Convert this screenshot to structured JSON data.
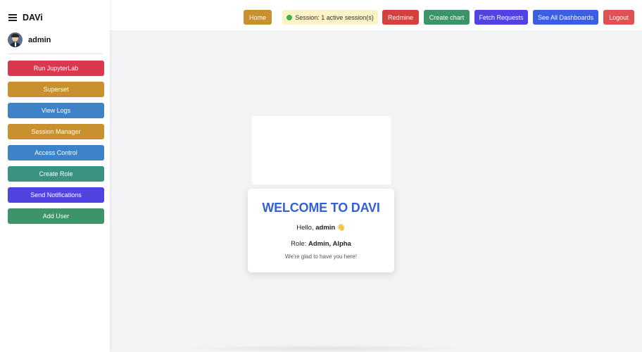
{
  "sidebar": {
    "brand": "DAVi",
    "username": "admin",
    "buttons": [
      {
        "label": "Run JupyterLab",
        "color": "#d9384f"
      },
      {
        "label": "Superset",
        "color": "#c8902f"
      },
      {
        "label": "View Logs",
        "color": "#3d83c8"
      },
      {
        "label": "Session Manager",
        "color": "#c8902f"
      },
      {
        "label": "Access Control",
        "color": "#3d83c8"
      },
      {
        "label": "Create Role",
        "color": "#3a9282"
      },
      {
        "label": "Send Notifications",
        "color": "#5143e0"
      },
      {
        "label": "Add User",
        "color": "#3d9468"
      }
    ]
  },
  "header": {
    "home_label": "Home",
    "session_text": "Session: 1 active session(s)",
    "redmine_label": "Redmine",
    "create_chart_label": "Create chart",
    "fetch_requests_label": "Fetch Requests",
    "see_all_dashboards_label": "See All Dashboards",
    "logout_label": "Logout",
    "colors": {
      "home": "#c8902f",
      "redmine": "#d3413b",
      "create_chart": "#3d9468",
      "fetch_requests": "#5143e0",
      "see_all_dashboards": "#3a5fe0",
      "logout": "#e05252"
    }
  },
  "welcome": {
    "title": "WELCOME TO DAVI",
    "hello_prefix": "Hello, ",
    "hello_name": "admin",
    "hello_emoji": "👋",
    "role_prefix": "Role: ",
    "role_value": "Admin, Alpha",
    "glad_text": "We're glad to have you here!"
  }
}
